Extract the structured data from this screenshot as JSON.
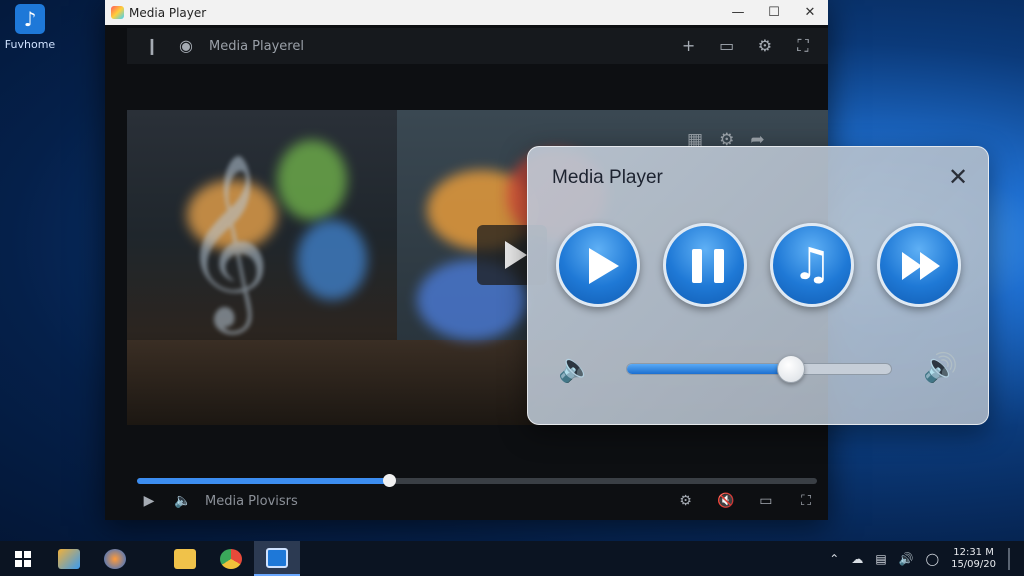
{
  "desktop": {
    "icon_label": "Fuvhome"
  },
  "main_window": {
    "title": "Media Player",
    "toolbar_title": "Media Playerel",
    "bottom_label": "Media Plovisrs",
    "progress": 0.37
  },
  "popup": {
    "title": "Media Player",
    "close_glyph": "✕",
    "volume": 0.62,
    "buttons": [
      "play-icon",
      "pause-icon",
      "music-note-icon",
      "fast-forward-icon"
    ]
  },
  "taskbar": {
    "clock_time": "12:31 M",
    "clock_date": "15/09/20",
    "accent": "#6aa8ff"
  }
}
